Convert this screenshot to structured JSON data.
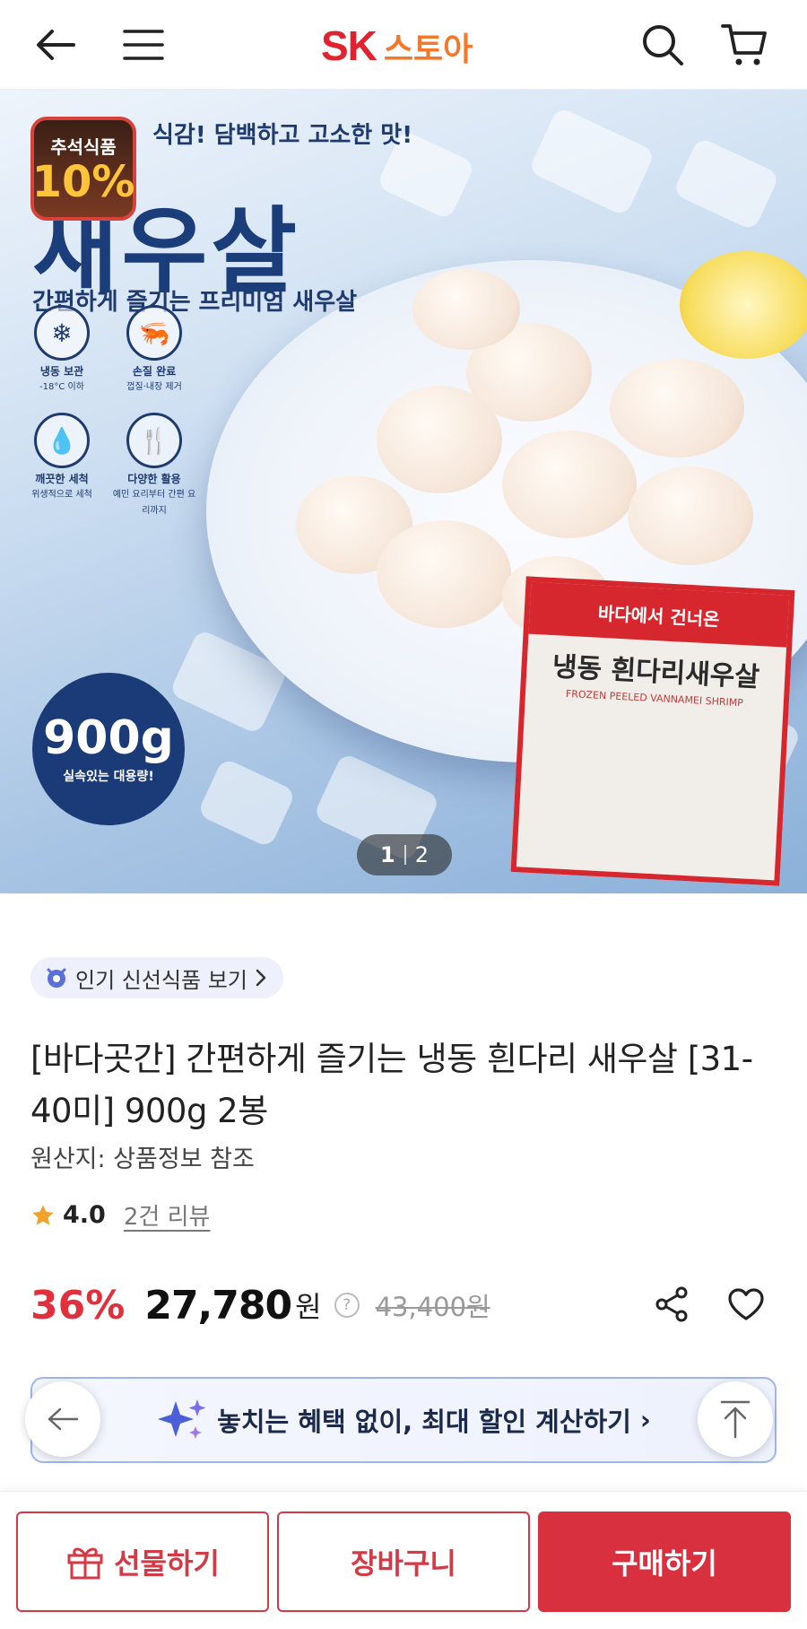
{
  "header": {
    "logo_brand": "SK",
    "logo_store": "스토아"
  },
  "hero": {
    "tagline_top": "식감! 담백하고 고소한 맛!",
    "product_name": "새우살",
    "subtitle": "간편하게 즐기는 프리미엄 새우살",
    "promo_badge": {
      "line1": "추석식품",
      "line2": "10%"
    },
    "features": [
      {
        "icon": "snowflake-icon",
        "label": "냉동 보관",
        "sub": "-18°C 이하"
      },
      {
        "icon": "shrimp-icon",
        "label": "손질 완료",
        "sub": "껍질·내장 제거"
      },
      {
        "icon": "water-drop-icon",
        "label": "깨끗한 세척",
        "sub": "위생적으로 세척"
      },
      {
        "icon": "utensils-icon",
        "label": "다양한 활용",
        "sub": "예민 요리부터 간편 요리까지"
      }
    ],
    "package": {
      "top": "바다에서 건너온",
      "title": "냉동 흰다리새우살",
      "sub": "FROZEN PEELED VANNAMEI SHRIMP"
    },
    "weight_badge": {
      "value": "900g",
      "caption": "실속있는 대용량!"
    },
    "pager": {
      "current": "1",
      "total": "2"
    }
  },
  "product": {
    "chip_label": "인기 신선식품 보기",
    "title": "[바다곳간] 간편하게 즐기는 냉동 흰다리 새우살 [31-40미] 900g 2봉",
    "origin": "원산지: 상품정보 참조",
    "rating": "4.0",
    "review_count": "2건 리뷰",
    "discount": "36%",
    "price": "27,780",
    "currency": "원",
    "original_price": "43,400원",
    "help_mark": "?"
  },
  "banner": {
    "text": "놓치는 혜택 없이, 최대 할인 계산하기",
    "chevron": "›"
  },
  "bottom_bar": {
    "gift": "선물하기",
    "cart": "장바구니",
    "buy": "구매하기"
  },
  "colors": {
    "brand_red": "#e0242f",
    "brand_orange": "#f4782a",
    "discount_red": "#e0303e",
    "buy_button": "#d8303f",
    "navy": "#1b3a78"
  }
}
